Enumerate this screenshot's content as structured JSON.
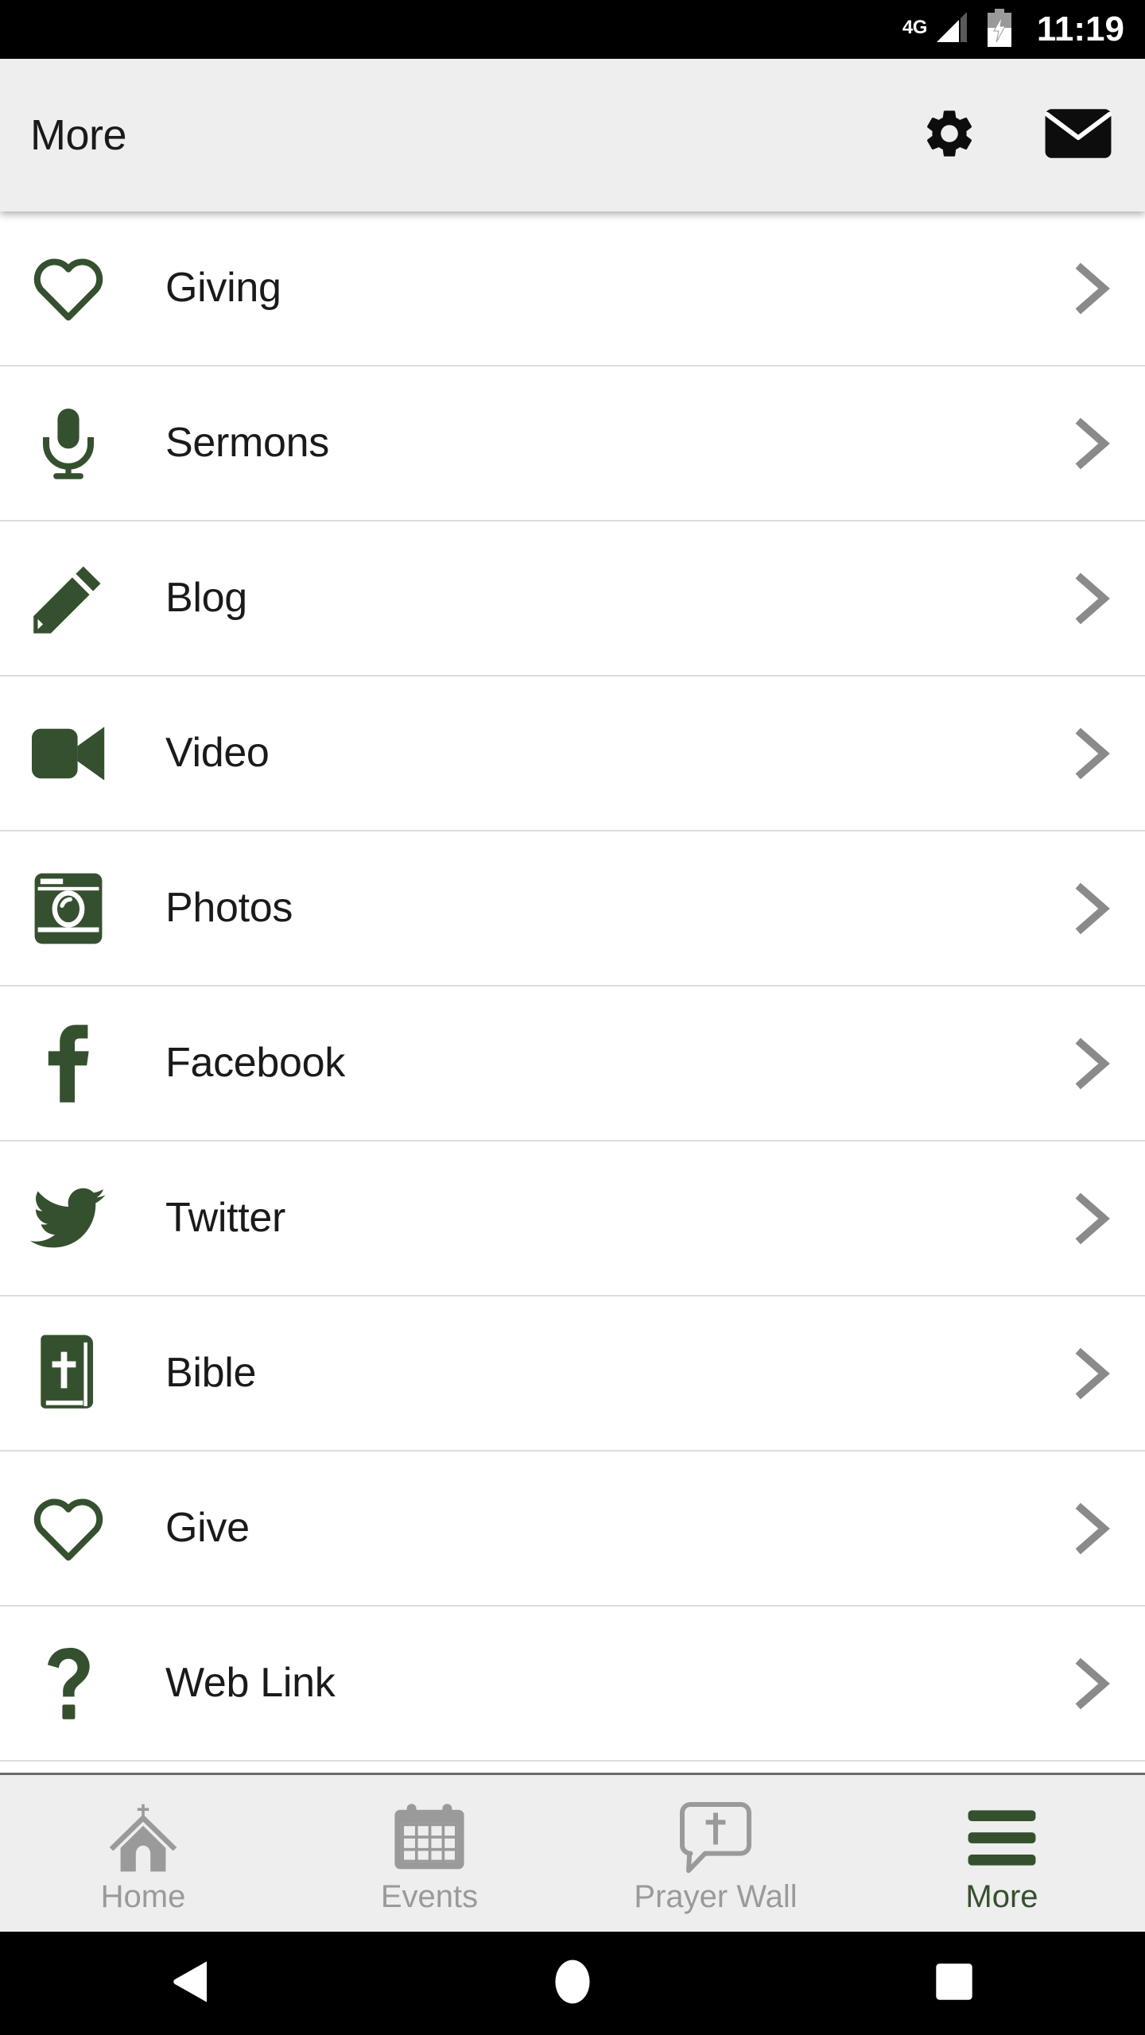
{
  "status_bar": {
    "network_type": "4G",
    "signal_icon": "signal-bars-icon",
    "battery_icon": "battery-charging-icon",
    "time": "11:19"
  },
  "header": {
    "title": "More",
    "settings_icon": "gear-icon",
    "mail_icon": "envelope-icon"
  },
  "colors": {
    "accent_green": "#35502f",
    "header_bg": "#eeeeee",
    "chevron_gray": "#8a8a8a",
    "inactive_tab": "#9a9a9a",
    "divider": "#dcdcdc"
  },
  "list": {
    "chevron_icon": "chevron-right-icon",
    "items": [
      {
        "label": "Giving",
        "icon": "heart-outline-icon"
      },
      {
        "label": "Sermons",
        "icon": "microphone-icon"
      },
      {
        "label": "Blog",
        "icon": "pencil-icon"
      },
      {
        "label": "Video",
        "icon": "video-camera-icon"
      },
      {
        "label": "Photos",
        "icon": "camera-icon"
      },
      {
        "label": "Facebook",
        "icon": "facebook-icon"
      },
      {
        "label": "Twitter",
        "icon": "twitter-bird-icon"
      },
      {
        "label": "Bible",
        "icon": "bible-book-icon"
      },
      {
        "label": "Give",
        "icon": "heart-outline-icon"
      },
      {
        "label": "Web Link",
        "icon": "question-mark-icon"
      }
    ]
  },
  "tab_bar": {
    "tabs": [
      {
        "label": "Home",
        "icon": "church-icon",
        "active": false
      },
      {
        "label": "Events",
        "icon": "calendar-icon",
        "active": false
      },
      {
        "label": "Prayer Wall",
        "icon": "cross-bubble-icon",
        "active": false
      },
      {
        "label": "More",
        "icon": "hamburger-menu-icon",
        "active": true
      }
    ]
  },
  "nav_bar": {
    "back": "back-triangle-icon",
    "home": "home-circle-icon",
    "recents": "recents-square-icon"
  }
}
